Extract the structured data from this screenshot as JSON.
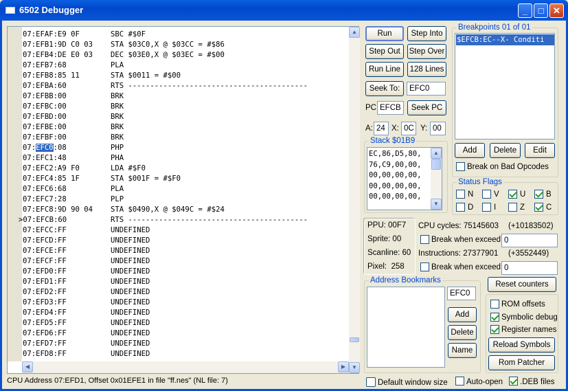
{
  "window": {
    "title": "6502 Debugger",
    "min_label": "_",
    "max_label": "□",
    "close_label": "✕"
  },
  "disasm": {
    "lines": [
      {
        "addr": "07:EFAF:E9 0F",
        "text": "SBC #$0F"
      },
      {
        "addr": "07:EFB1:9D C0 03",
        "text": "STA $03C0,X @ $03CC = #$86"
      },
      {
        "addr": "07:EFB4:DE E0 03",
        "text": "DEC $03E0,X @ $03EC = #$00"
      },
      {
        "addr": "07:EFB7:68",
        "text": "PLA"
      },
      {
        "addr": "07:EFB8:85 11",
        "text": "STA $0011 = #$00"
      },
      {
        "addr": "07:EFBA:60",
        "text": "RTS -----------------------------------------"
      },
      {
        "addr": "07:EFBB:00",
        "text": "BRK"
      },
      {
        "addr": "07:EFBC:00",
        "text": "BRK"
      },
      {
        "addr": "07:EFBD:00",
        "text": "BRK"
      },
      {
        "addr": "07:EFBE:00",
        "text": "BRK"
      },
      {
        "addr": "07:EFBF:00",
        "text": "BRK"
      },
      {
        "addr_pre": "07:",
        "addr_sel": "EFC0",
        "addr_post": ":08",
        "text": "PHP"
      },
      {
        "addr": "07:EFC1:48",
        "text": "PHA"
      },
      {
        "addr": "07:EFC2:A9 F0",
        "text": "LDA #$F0"
      },
      {
        "addr": "07:EFC4:85 1F",
        "text": "STA $001F = #$F0"
      },
      {
        "addr": "07:EFC6:68",
        "text": "PLA"
      },
      {
        "addr": "07:EFC7:28",
        "text": "PLP"
      },
      {
        "addr": "07:EFC8:9D 90 04",
        "text": "STA $0490,X @ $049C = #$24"
      },
      {
        "addr": ">07:EFCB:60",
        "text": "RTS -----------------------------------------"
      },
      {
        "addr": "07:EFCC:FF",
        "text": "UNDEFINED"
      },
      {
        "addr": "07:EFCD:FF",
        "text": "UNDEFINED"
      },
      {
        "addr": "07:EFCE:FF",
        "text": "UNDEFINED"
      },
      {
        "addr": "07:EFCF:FF",
        "text": "UNDEFINED"
      },
      {
        "addr": "07:EFD0:FF",
        "text": "UNDEFINED"
      },
      {
        "addr": "07:EFD1:FF",
        "text": "UNDEFINED"
      },
      {
        "addr": "07:EFD2:FF",
        "text": "UNDEFINED"
      },
      {
        "addr": "07:EFD3:FF",
        "text": "UNDEFINED"
      },
      {
        "addr": "07:EFD4:FF",
        "text": "UNDEFINED"
      },
      {
        "addr": "07:EFD5:FF",
        "text": "UNDEFINED"
      },
      {
        "addr": "07:EFD6:FF",
        "text": "UNDEFINED"
      },
      {
        "addr": "07:EFD7:FF",
        "text": "UNDEFINED"
      },
      {
        "addr": "07:EFD8:FF",
        "text": "UNDEFINED"
      }
    ]
  },
  "controls": {
    "run": "Run",
    "step_into": "Step Into",
    "step_out": "Step Out",
    "step_over": "Step Over",
    "run_line": "Run Line",
    "lines128": "128 Lines",
    "seek_to": "Seek To:",
    "seek_value": "EFC0",
    "pc_label": "PC:",
    "pc_value": "EFCB",
    "seek_pc": "Seek PC",
    "a_label": "A:",
    "a_value": "24",
    "x_label": "X:",
    "x_value": "0C",
    "y_label": "Y:",
    "y_value": "00"
  },
  "stack": {
    "title": "Stack $01B9",
    "lines": [
      "EC,86,D5,80,",
      "76,C9,00,00,",
      "00,00,00,00,",
      "00,00,00,00,",
      "00,00,00,00,"
    ]
  },
  "breakpoints": {
    "title": "Breakpoints 01 of 01",
    "item": "$EFCB:EC--X- Conditi",
    "add": "Add",
    "delete": "Delete",
    "edit": "Edit",
    "break_bad": "Break on Bad Opcodes"
  },
  "flags": {
    "title": "Status Flags",
    "items": [
      {
        "label": "N",
        "checked": false
      },
      {
        "label": "V",
        "checked": false
      },
      {
        "label": "U",
        "checked": true
      },
      {
        "label": "B",
        "checked": true
      },
      {
        "label": "D",
        "checked": false
      },
      {
        "label": "I",
        "checked": false
      },
      {
        "label": "Z",
        "checked": false
      },
      {
        "label": "C",
        "checked": true
      }
    ]
  },
  "ppu": {
    "ppu": "PPU: 00F7",
    "sprite": "Sprite: 00",
    "scanline": "Scanline: 60",
    "pixel": "Pixel:  258"
  },
  "counters": {
    "cpu_cycles": "CPU cycles: 75145603",
    "cpu_delta": "(+10183502)",
    "break_exceed": "Break when exceed",
    "cycles_value": "0",
    "instructions": "Instructions: 27377901",
    "instr_delta": "(+3552449)",
    "instr_value": "0",
    "reset": "Reset counters"
  },
  "bookmarks": {
    "title": "Address Bookmarks",
    "input": "EFC0",
    "add": "Add",
    "delete": "Delete",
    "name": "Name"
  },
  "options": {
    "rom_offsets": "ROM offsets",
    "symbolic": "Symbolic debug",
    "register_names": "Register names",
    "reload": "Reload Symbols",
    "rom_patcher": "Rom Patcher"
  },
  "bottom": {
    "status": "CPU Address 07:EFD1, Offset 0x01EFE1 in file \"ff.nes\" (NL file: 7)",
    "default_size": "Default window size",
    "auto_open": "Auto-open",
    "deb_files": ".DEB files"
  },
  "scrollbar_glyphs": {
    "up": "▲",
    "down": "▼",
    "left": "◀",
    "right": "▶"
  }
}
